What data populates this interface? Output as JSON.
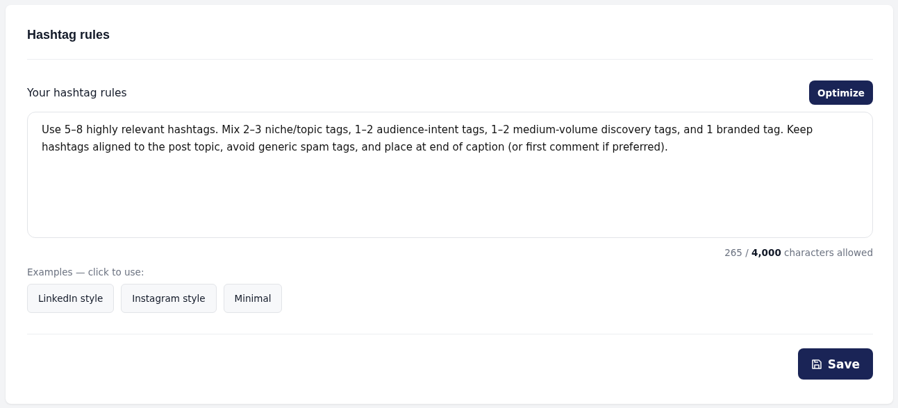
{
  "card": {
    "title": "Hashtag rules"
  },
  "rules": {
    "label": "Your hashtag rules",
    "optimize_button": "Optimize",
    "value": "Use 5–8 highly relevant hashtags. Mix 2–3 niche/topic tags, 1–2 audience-intent tags, 1–2 medium-volume discovery tags, and 1 branded tag. Keep hashtags aligned to the post topic, avoid generic spam tags, and place at end of caption (or first comment if preferred).",
    "counter": "265 / **4,000** characters allowed"
  },
  "examples": {
    "label": "Examples — click to use:",
    "chips": [
      "LinkedIn style",
      "Instagram style",
      "Minimal"
    ]
  },
  "save_button": "Save"
}
